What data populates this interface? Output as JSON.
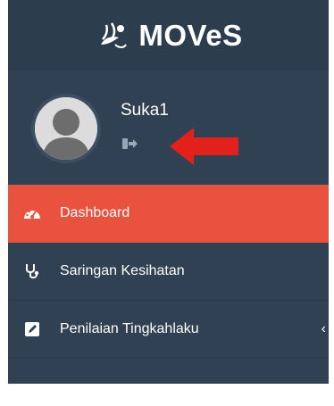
{
  "brand": {
    "title": "MOVeS",
    "logo_icon": "leaf-ribbon-logo"
  },
  "user": {
    "name": "Suka1",
    "logout_icon": "sign-out-icon"
  },
  "menu": {
    "items": [
      {
        "label": "Dashboard",
        "icon": "dashboard-gauge-icon",
        "active": true
      },
      {
        "label": "Saringan Kesihatan",
        "icon": "stethoscope-icon",
        "active": false
      },
      {
        "label": "Penilaian Tingkahlaku",
        "icon": "edit-icon",
        "active": false,
        "chevron": "‹"
      }
    ]
  },
  "colors": {
    "sidebar": "#2f4152",
    "brand_bar": "#2c3d4e",
    "active": "#e8523f",
    "annotation_arrow": "#e2211c"
  }
}
